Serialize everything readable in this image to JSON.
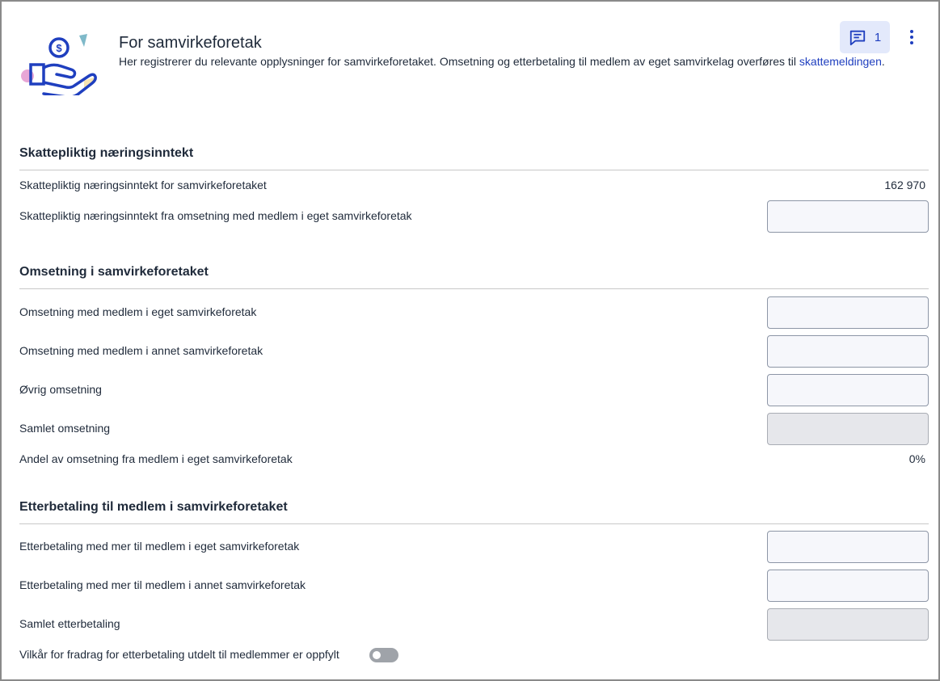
{
  "header": {
    "title": "For samvirkeforetak",
    "subtitle_text": "Her registrerer du relevante opplysninger for samvirkeforetaket. Omsetning og etterbetaling til medlem av eget samvirkelag overføres til ",
    "subtitle_link": "skattemeldingen",
    "subtitle_end": ".",
    "comment_count": "1"
  },
  "sections": {
    "income": {
      "title": "Skattepliktig næringsinntekt",
      "row1_label": "Skattepliktig næringsinntekt for samvirkeforetaket",
      "row1_value": "162 970",
      "row2_label": "Skattepliktig næringsinntekt fra omsetning med medlem i eget samvirkeforetak",
      "row2_value": ""
    },
    "turnover": {
      "title": "Omsetning i samvirkeforetaket",
      "row1_label": "Omsetning med medlem i eget samvirkeforetak",
      "row1_value": "",
      "row2_label": "Omsetning med medlem i annet samvirkeforetak",
      "row2_value": "",
      "row3_label": "Øvrig omsetning",
      "row3_value": "",
      "row4_label": "Samlet omsetning",
      "row4_value": "",
      "row5_label": "Andel av omsetning fra medlem i eget samvirkeforetak",
      "row5_value": "0%"
    },
    "backpay": {
      "title": "Etterbetaling til medlem i samvirkeforetaket",
      "row1_label": "Etterbetaling med mer til medlem i eget samvirkeforetak",
      "row1_value": "",
      "row2_label": "Etterbetaling med mer til medlem i annet samvirkeforetak",
      "row2_value": "",
      "row3_label": "Samlet etterbetaling",
      "row3_value": "",
      "toggle_label": "Vilkår for fradrag for etterbetaling utdelt til medlemmer er oppfylt",
      "toggle_on": false
    }
  },
  "colors": {
    "accent": "#1f3fbf",
    "comment_bg": "#e3e9fb",
    "illustration_pink": "#e8a6d6",
    "illustration_teal": "#7fb9c9",
    "illustration_yellow": "#f7e3b0"
  },
  "icons": {
    "comment": "comment-icon",
    "more": "more-vertical-icon",
    "illustration": "hand-coin-illustration"
  }
}
